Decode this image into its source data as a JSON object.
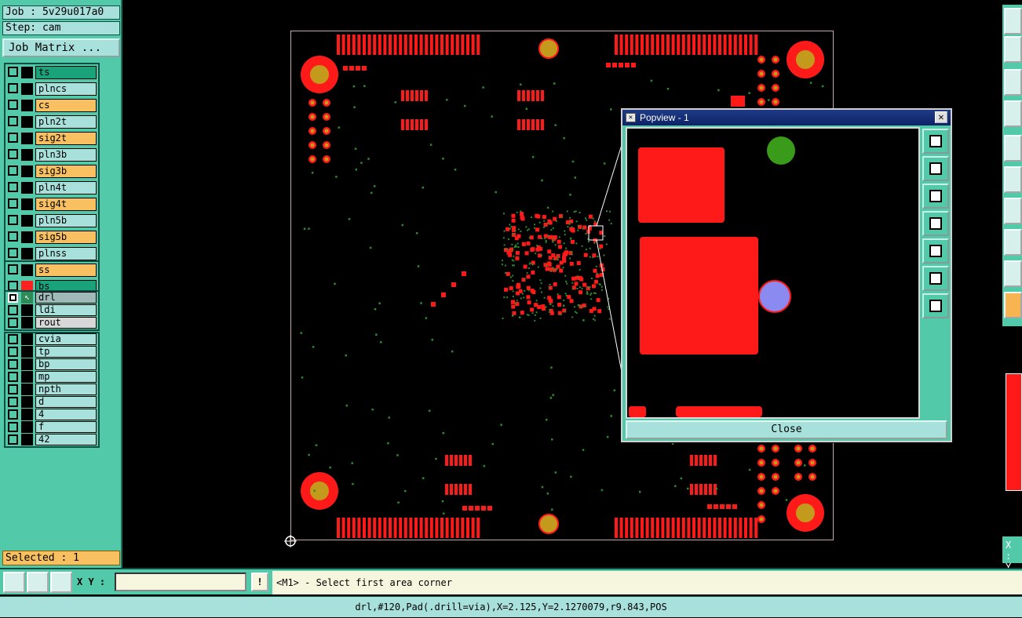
{
  "job": "Job : 5v29u017a0",
  "step": "Step: cam",
  "job_matrix": "Job Matrix ...",
  "layer_groups": [
    [
      {
        "name": "ts",
        "color": "#1aa37a",
        "swatch": "#000",
        "dark": false
      },
      {
        "name": "plncs",
        "color": "#a8e0dc",
        "swatch": "#000",
        "dark": false
      },
      {
        "name": "cs",
        "color": "#f8c060",
        "swatch": "#000",
        "dark": false
      },
      {
        "name": "pln2t",
        "color": "#a8e0dc",
        "swatch": "#000",
        "dark": false
      },
      {
        "name": "sig2t",
        "color": "#f8c060",
        "swatch": "#000",
        "dark": false
      },
      {
        "name": "pln3b",
        "color": "#a8e0dc",
        "swatch": "#000",
        "dark": false
      },
      {
        "name": "sig3b",
        "color": "#f8c060",
        "swatch": "#000",
        "dark": false
      },
      {
        "name": "pln4t",
        "color": "#a8e0dc",
        "swatch": "#000",
        "dark": false
      },
      {
        "name": "sig4t",
        "color": "#f8c060",
        "swatch": "#000",
        "dark": false
      },
      {
        "name": "pln5b",
        "color": "#a8e0dc",
        "swatch": "#000",
        "dark": false
      },
      {
        "name": "sig5b",
        "color": "#f8c060",
        "swatch": "#000",
        "dark": false
      },
      {
        "name": "plnss",
        "color": "#a8e0dc",
        "swatch": "#000",
        "dark": false
      }
    ],
    [
      {
        "name": "ss",
        "color": "#f8c060",
        "swatch": "#000",
        "dark": false
      },
      {
        "name": "bs",
        "color": "#1aa37a",
        "swatch": "#ff2020",
        "dark": false
      }
    ],
    [
      {
        "name": "drl",
        "color": "#9fb9b9",
        "swatch": "#2e8b57",
        "dark": true,
        "arrow": true
      },
      {
        "name": "ldi",
        "color": "#a8e0dc",
        "swatch": "#000",
        "dark": false
      },
      {
        "name": "rout",
        "color": "#d8d8d8",
        "swatch": "#000",
        "dark": false
      }
    ],
    [
      {
        "name": "cvia",
        "color": "#a8e0dc",
        "swatch": "#000",
        "dark": false
      },
      {
        "name": "tp",
        "color": "#a8e0dc",
        "swatch": "#000",
        "dark": false
      },
      {
        "name": "bp",
        "color": "#a8e0dc",
        "swatch": "#000",
        "dark": false
      },
      {
        "name": "mp",
        "color": "#a8e0dc",
        "swatch": "#000",
        "dark": false
      },
      {
        "name": "npth",
        "color": "#a8e0dc",
        "swatch": "#000",
        "dark": false
      },
      {
        "name": "d",
        "color": "#a8e0dc",
        "swatch": "#000",
        "dark": false
      },
      {
        "name": "4",
        "color": "#a8e0dc",
        "swatch": "#000",
        "dark": false
      },
      {
        "name": "f",
        "color": "#a8e0dc",
        "swatch": "#000",
        "dark": false
      },
      {
        "name": "42",
        "color": "#a8e0dc",
        "swatch": "#000",
        "dark": false
      }
    ]
  ],
  "selected": "Selected : 1",
  "popview": {
    "title": "Popview - 1",
    "close_label": "Close",
    "close_x": "✕",
    "title_icon": "✕"
  },
  "xy_label": "X Y :",
  "xy_value": "",
  "excl": "!",
  "prompt": "<M1> - Select first area corner",
  "status": "drl,#120,Pad(.drill=via),X=2.125,Y=2.1270079,r9.843,POS",
  "coords_x": "X :",
  "coords_y": "Y :",
  "colors": {
    "pad": "#ff1a1a",
    "via": "#2f8a2f",
    "hole": "#c49a1c",
    "panel": "#52c9a8"
  }
}
